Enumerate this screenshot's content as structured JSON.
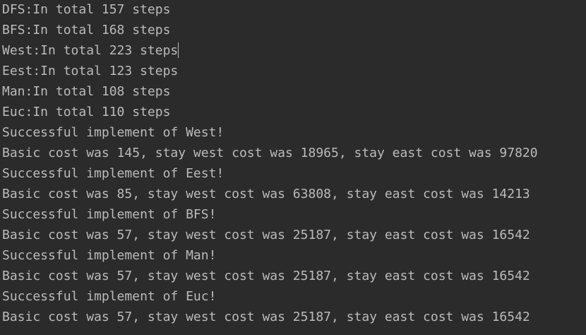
{
  "console": {
    "lines": [
      "DFS:In total 157 steps",
      "BFS:In total 168 steps",
      "West:In total 223 steps",
      "Eest:In total 123 steps",
      "Man:In total 108 steps",
      "Euc:In total 110 steps",
      "Successful implement of West!",
      "Basic cost was 145, stay west cost was 18965, stay east cost was 97820",
      "Successful implement of Eest!",
      "Basic cost was 85, stay west cost was 63808, stay east cost was 14213",
      "Successful implement of BFS!",
      "Basic cost was 57, stay west cost was 25187, stay east cost was 16542",
      "Successful implement of Man!",
      "Basic cost was 57, stay west cost was 25187, stay east cost was 16542",
      "Successful implement of Euc!",
      "Basic cost was 57, stay west cost was 25187, stay east cost was 16542"
    ]
  },
  "colors": {
    "background": "#2b2b2b",
    "text": "#bbbbbb"
  }
}
